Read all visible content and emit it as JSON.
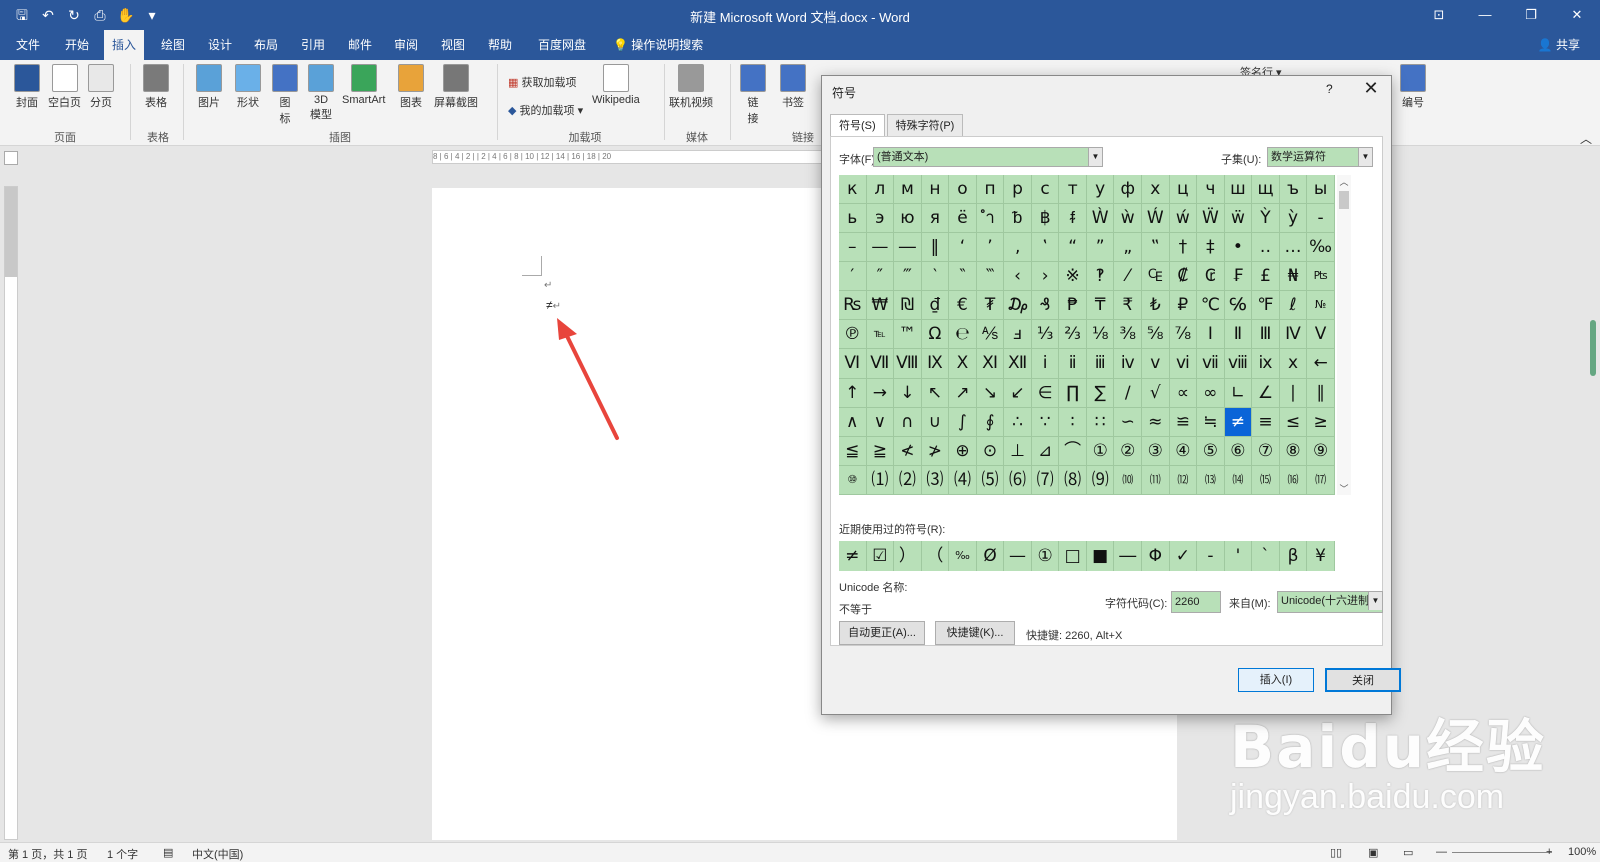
{
  "titlebar": {
    "title": "新建 Microsoft Word 文档.docx  -  Word",
    "qat": [
      "save-icon",
      "undo-icon",
      "redo-icon",
      "print-preview-icon",
      "touch-mode-icon",
      "customize-icon"
    ],
    "qat_glyphs": [
      "🖫",
      "↶",
      "↻",
      "⎙",
      "✋",
      "▾"
    ],
    "controls": [
      "⊡",
      "—",
      "❐",
      "✕"
    ]
  },
  "tabs": {
    "items": [
      "文件",
      "开始",
      "插入",
      "绘图",
      "设计",
      "布局",
      "引用",
      "邮件",
      "审阅",
      "视图",
      "帮助",
      "百度网盘"
    ],
    "active": "插入",
    "search": "操作说明搜索",
    "share": "共享"
  },
  "ribbon": {
    "buttons": [
      {
        "label": "封面",
        "color": "#2b579a"
      },
      {
        "label": "空白页",
        "color": "#ffffff"
      },
      {
        "label": "分页",
        "color": "#e8e8e8"
      },
      {
        "label": "表格",
        "color": "#7a7a7a"
      },
      {
        "label": "图片",
        "color": "#5aa1d8"
      },
      {
        "label": "形状",
        "color": "#6ab0e8"
      },
      {
        "label": "图\n标",
        "color": "#4472c4"
      },
      {
        "label": "3D\n模型",
        "color": "#5aa1d8"
      },
      {
        "label": "SmartArt",
        "color": "#3aa55a"
      },
      {
        "label": "图表",
        "color": "#e8a33a"
      },
      {
        "label": "屏幕截图",
        "color": "#777777"
      },
      {
        "label": "Wikipedia",
        "color": "#ffffff"
      },
      {
        "label": "联机视频",
        "color": "#999999"
      },
      {
        "label": "链\n接",
        "color": "#4472c4"
      },
      {
        "label": "书签",
        "color": "#4472c4"
      },
      {
        "label": "编号",
        "color": "#4472c4"
      }
    ],
    "small": {
      "get_addins": "获取加载项",
      "my_addins": "我的加载项",
      "signature": "签名行"
    },
    "groups": [
      "页面",
      "表格",
      "插图",
      "加载项",
      "媒体",
      "链接"
    ]
  },
  "document": {
    "para1": "↵",
    "para2_char": "≠",
    "para2_mark": "↵",
    "ruler_h": "8 | 6 | 4 | 2 |   | 2 | 4 | 6 | 8 | 10 | 12 | 14 | 16 | 18 | 20"
  },
  "statusbar": {
    "page": "第 1 页，共 1 页",
    "words": "1 个字",
    "lang": "中文(中国)",
    "zoom": "100%"
  },
  "watermark": {
    "logo": "Baidu经验",
    "url": "jingyan.baidu.com"
  },
  "dialog": {
    "title": "符号",
    "help": "?",
    "close": "✕",
    "tabs": [
      "符号(S)",
      "特殊字符(P)"
    ],
    "font_label": "字体(F):",
    "font_value": "(普通文本)",
    "subset_label": "子集(U):",
    "subset_value": "数学运算符",
    "symbols": [
      "к",
      "л",
      "м",
      "н",
      "о",
      "п",
      "р",
      "с",
      "т",
      "у",
      "ф",
      "х",
      "ц",
      "ч",
      "ш",
      "щ",
      "ъ",
      "ы",
      "ь",
      "э",
      "ю",
      "я",
      "ё",
      "ำ",
      "ᵬ",
      "฿",
      "ᵮ",
      "Ẁ",
      "ẁ",
      "Ẃ",
      "ẃ",
      "Ẅ",
      "ẅ",
      "Ỳ",
      "ỳ",
      "‐",
      "–",
      "—",
      "―",
      "‖",
      "‘",
      "’",
      "‚",
      "‛",
      "“",
      "”",
      "„",
      "‟",
      "†",
      "‡",
      "•",
      "‥",
      "…",
      "‰",
      "′",
      "″",
      "‴",
      "‵",
      "‶",
      "‷",
      "‹",
      "›",
      "※",
      "‽",
      "⁄",
      "₠",
      "₡",
      "₢",
      "₣",
      "£",
      "₦",
      "₧",
      "₨",
      "₩",
      "₪",
      "₫",
      "€",
      "₮",
      "₯",
      "₰",
      "₱",
      "₸",
      "₹",
      "₺",
      "₽",
      "℃",
      "℅",
      "℉",
      "ℓ",
      "№",
      "℗",
      "℡",
      "™",
      "Ω",
      "℮",
      "⅍",
      "ⅎ",
      "⅓",
      "⅔",
      "⅛",
      "⅜",
      "⅝",
      "⅞",
      "Ⅰ",
      "Ⅱ",
      "Ⅲ",
      "Ⅳ",
      "Ⅴ",
      "Ⅵ",
      "Ⅶ",
      "Ⅷ",
      "Ⅸ",
      "Ⅹ",
      "Ⅺ",
      "Ⅻ",
      "ⅰ",
      "ⅱ",
      "ⅲ",
      "ⅳ",
      "ⅴ",
      "ⅵ",
      "ⅶ",
      "ⅷ",
      "ⅸ",
      "ⅹ",
      "←",
      "↑",
      "→",
      "↓",
      "↖",
      "↗",
      "↘",
      "↙",
      "∈",
      "∏",
      "∑",
      "∕",
      "√",
      "∝",
      "∞",
      "∟",
      "∠",
      "∣",
      "∥",
      "∧",
      "∨",
      "∩",
      "∪",
      "∫",
      "∮",
      "∴",
      "∵",
      "∶",
      "∷",
      "∽",
      "≈",
      "≌",
      "≒",
      "≠",
      "≡",
      "≤",
      "≥",
      "≦",
      "≧",
      "≮",
      "≯",
      "⊕",
      "⊙",
      "⊥",
      "⊿",
      "⌒",
      "①",
      "②",
      "③",
      "④",
      "⑤",
      "⑥",
      "⑦",
      "⑧",
      "⑨",
      "⑩",
      "⑴",
      "⑵",
      "⑶",
      "⑷",
      "⑸",
      "⑹",
      "⑺",
      "⑻",
      "⑼",
      "⑽",
      "⑾",
      "⑿",
      "⒀",
      "⒁",
      "⒂",
      "⒃",
      "⒄"
    ],
    "selected_symbol": "≠",
    "recent_label": "近期使用过的符号(R):",
    "recent": [
      "≠",
      "☑",
      "）",
      "（",
      "‰",
      "Ø",
      "—",
      "①",
      "□",
      "■",
      "―",
      "Φ",
      "✓",
      "-",
      "'",
      "`",
      "β",
      "¥"
    ],
    "unicode_label": "Unicode 名称:",
    "unicode_name": "不等于",
    "code_label": "字符代码(C):",
    "code_value": "2260",
    "from_label": "来自(M):",
    "from_value": "Unicode(十六进制)",
    "autocorrect": "自动更正(A)...",
    "shortcut_btn": "快捷键(K)...",
    "shortcut_text": "快捷键: 2260, Alt+X",
    "insert": "插入(I)",
    "cancel": "关闭"
  }
}
